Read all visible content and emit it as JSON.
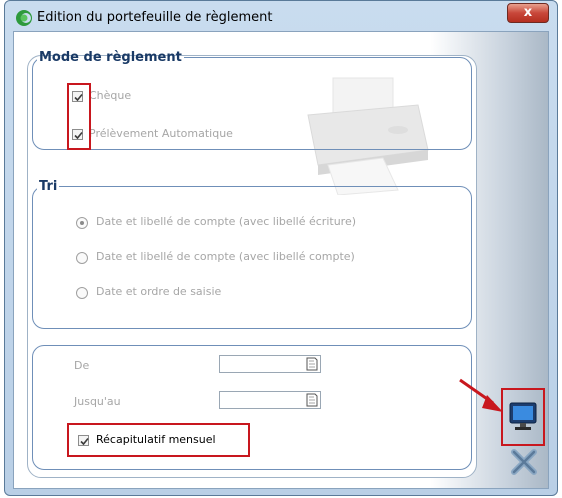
{
  "window": {
    "title": "Edition du portefeuille de règlement",
    "close_label": "x"
  },
  "mode_reglement": {
    "legend": "Mode de règlement",
    "options": [
      {
        "label": "Chèque",
        "checked": true
      },
      {
        "label": "Prélèvement Automatique",
        "checked": true
      }
    ]
  },
  "tri": {
    "legend": "Tri",
    "options": [
      {
        "label": "Date et libellé de compte (avec libellé écriture)",
        "selected": true
      },
      {
        "label": "Date et libellé de compte (avec libellé compte)",
        "selected": false
      },
      {
        "label": "Date et ordre de saisie",
        "selected": false
      }
    ]
  },
  "periode": {
    "de_label": "De",
    "de_value": "",
    "jusquau_label": "Jusqu'au",
    "jusquau_value": "",
    "recap_label": "Récapitulatif mensuel",
    "recap_checked": true
  },
  "icons": {
    "app": "app-logo-icon",
    "printer": "printer-watermark-icon",
    "display": "monitor-preview-icon",
    "cancel": "cancel-x-icon",
    "calendar": "calendar-icon",
    "arrow": "red-arrow-icon"
  },
  "colors": {
    "highlight_red": "#c8171e",
    "legend_blue": "#1a3a66",
    "disabled_text": "#a6a6a6"
  }
}
